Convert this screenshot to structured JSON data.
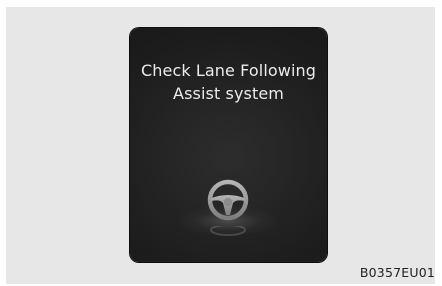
{
  "display": {
    "message_line1": "Check Lane Following",
    "message_line2": "Assist system",
    "icon": "steering-wheel-icon"
  },
  "figure_code": "B0357EU01",
  "colors": {
    "frame_background": "#e7e7e7",
    "display_background": "#1d1d1d",
    "message_text": "#ececec",
    "icon_gray": "#9a9a9a"
  }
}
